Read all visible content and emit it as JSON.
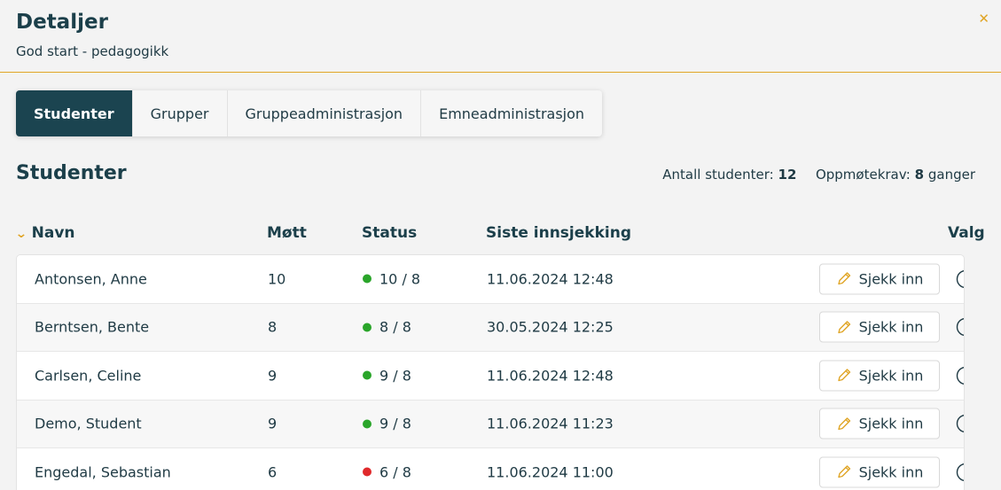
{
  "header": {
    "title": "Detaljer",
    "subtitle": "God start - pedagogikk",
    "close_icon": "close-icon"
  },
  "tabs": [
    {
      "label": "Studenter",
      "active": true
    },
    {
      "label": "Grupper",
      "active": false
    },
    {
      "label": "Gruppeadministrasjon",
      "active": false
    },
    {
      "label": "Emneadministrasjon",
      "active": false
    }
  ],
  "section": {
    "title": "Studenter",
    "count_label": "Antall studenter:",
    "count_value": "12",
    "req_label": "Oppmøtekrav:",
    "req_value": "8",
    "req_unit": "ganger"
  },
  "columns": {
    "name": "Navn",
    "mott": "Møtt",
    "status": "Status",
    "siste": "Siste innsjekking",
    "valg": "Valg"
  },
  "rows": [
    {
      "name": "Antonsen, Anne",
      "mott": "10",
      "status": "10 / 8",
      "status_color": "#2aa52a",
      "siste": "11.06.2024 12:48",
      "action": "Sjekk inn"
    },
    {
      "name": "Berntsen, Bente",
      "mott": "8",
      "status": "8 / 8",
      "status_color": "#2aa52a",
      "siste": "30.05.2024 12:25",
      "action": "Sjekk inn"
    },
    {
      "name": "Carlsen, Celine",
      "mott": "9",
      "status": "9 / 8",
      "status_color": "#2aa52a",
      "siste": "11.06.2024 12:48",
      "action": "Sjekk inn"
    },
    {
      "name": "Demo, Student",
      "mott": "9",
      "status": "9 / 8",
      "status_color": "#2aa52a",
      "siste": "11.06.2024 11:23",
      "action": "Sjekk inn"
    },
    {
      "name": "Engedal, Sebastian",
      "mott": "6",
      "status": "6 / 8",
      "status_color": "#e0292b",
      "siste": "11.06.2024 11:00",
      "action": "Sjekk inn"
    }
  ],
  "colors": {
    "accent": "#e0a526",
    "primary": "#1b4450"
  }
}
